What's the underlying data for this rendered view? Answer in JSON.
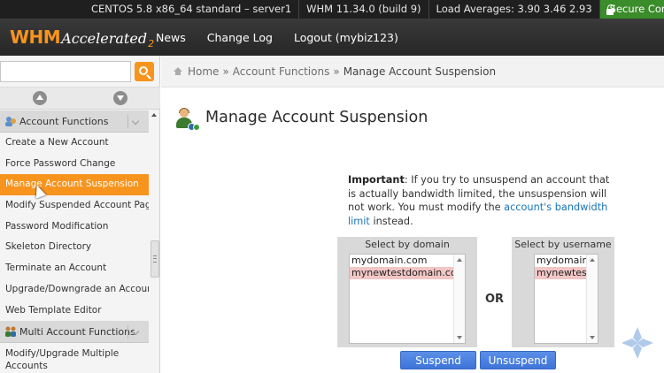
{
  "statusbar": {
    "server": "CENTOS 5.8 x86_64 standard – server1",
    "whm_version": "WHM 11.34.0 (build 9)",
    "load": "Load Averages: 3.90 3.46 2.93",
    "secure": "Secure Connecti"
  },
  "header": {
    "logo_whm": "WHM",
    "logo_accelerated": "Accelerated",
    "logo_version": "2",
    "nav": [
      "News",
      "Change Log",
      "Logout (mybiz123)"
    ]
  },
  "sidebar": {
    "search_placeholder": "",
    "groups": [
      {
        "label": "Account Functions",
        "items": [
          "Create a New Account",
          "Force Password Change",
          "Manage Account Suspension",
          "Modify Suspended Account Page",
          "Password Modification",
          "Skeleton Directory",
          "Terminate an Account",
          "Upgrade/Downgrade an Account",
          "Web Template Editor"
        ],
        "active_index": 2
      },
      {
        "label": "Multi Account Functions",
        "items": [
          "Modify/Upgrade Multiple Accounts"
        ]
      }
    ]
  },
  "breadcrumb": {
    "home": "Home",
    "sep": "»",
    "section": "Account Functions",
    "current": "Manage Account Suspension"
  },
  "page": {
    "title": "Manage Account Suspension",
    "notice_bold": "Important",
    "notice_text": ": If you try to unsuspend an account that is actually bandwidth limited, the unsuspension will not work. You must modify the ",
    "notice_link": "account's bandwidth limit",
    "notice_tail": " instead."
  },
  "select_domain": {
    "caption": "Select by domain",
    "options": [
      "mydomain.com",
      "mynewtestdomain.com"
    ],
    "selected_index": 1
  },
  "select_user": {
    "caption": "Select by username",
    "options": [
      "mydomain",
      "mynewtes"
    ],
    "selected_index": 1
  },
  "or_label": "OR",
  "buttons": {
    "suspend": "Suspend",
    "unsuspend": "Unsuspend"
  },
  "colors": {
    "accent": "#f7941d",
    "header_bg": "#262626",
    "secure_bg": "#3b8c2a",
    "button": "#4a7fe0",
    "selected_option": "#f3c6c6"
  }
}
